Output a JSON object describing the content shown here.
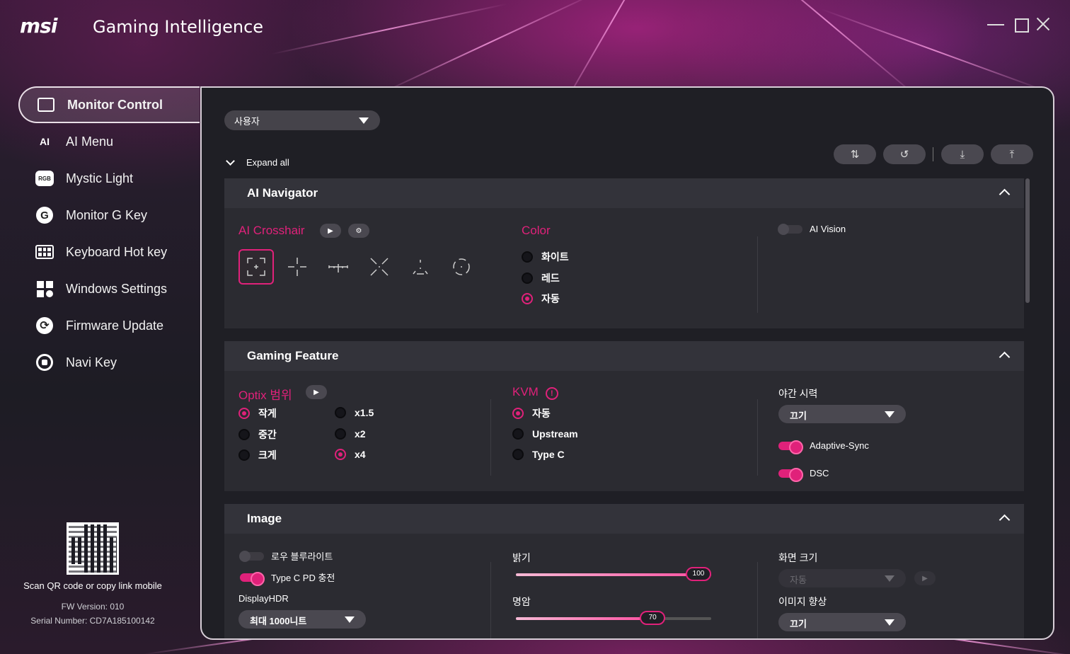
{
  "app": {
    "brand": "msi",
    "title": "Gaming Intelligence"
  },
  "sidebar": {
    "items": [
      {
        "label": "Monitor Control",
        "icon": "monitor-icon",
        "active": true
      },
      {
        "label": "AI Menu",
        "icon": "ai-menu-icon"
      },
      {
        "label": "Mystic Light",
        "icon": "rgb-icon",
        "icon_text": "RGB"
      },
      {
        "label": "Monitor G Key",
        "icon": "g-key-icon",
        "icon_text": "G"
      },
      {
        "label": "Keyboard Hot key",
        "icon": "keyboard-icon"
      },
      {
        "label": "Windows Settings",
        "icon": "windows-settings-icon"
      },
      {
        "label": "Firmware Update",
        "icon": "firmware-update-icon"
      },
      {
        "label": "Navi Key",
        "icon": "navi-key-icon"
      }
    ],
    "ai_icon_text": "AI",
    "qr_text": "Scan QR code or copy link mobile",
    "fw_version": "FW Version: 010",
    "serial": "Serial Number: CD7A185100142"
  },
  "main": {
    "profile": "사용자",
    "expand_all": "Expand all",
    "toolbar": [
      {
        "icon": "sort-icon",
        "glyph": "⇅"
      },
      {
        "icon": "reset-icon",
        "glyph": "↺"
      },
      {
        "icon": "import-icon",
        "glyph": "⤓"
      },
      {
        "icon": "export-icon",
        "glyph": "⤒"
      }
    ]
  },
  "ai_navigator": {
    "title": "AI Navigator",
    "crosshair_title": "AI Crosshair",
    "color_title": "Color",
    "colors": [
      {
        "label": "화이트",
        "selected": false
      },
      {
        "label": "레드",
        "selected": false
      },
      {
        "label": "자동",
        "selected": true
      }
    ],
    "ai_vision_label": "AI Vision",
    "ai_vision_on": false
  },
  "gaming_feature": {
    "title": "Gaming Feature",
    "optix_title": "Optix 범위",
    "optix_sizes": [
      {
        "label": "작게",
        "selected": true
      },
      {
        "label": "중간",
        "selected": false
      },
      {
        "label": "크게",
        "selected": false
      }
    ],
    "optix_zoom": [
      {
        "label": "x1.5",
        "selected": false
      },
      {
        "label": "x2",
        "selected": false
      },
      {
        "label": "x4",
        "selected": true
      }
    ],
    "kvm_title": "KVM",
    "kvm_warn": "!",
    "kvm_options": [
      {
        "label": "자동",
        "selected": true
      },
      {
        "label": "Upstream",
        "selected": false
      },
      {
        "label": "Type C",
        "selected": false
      }
    ],
    "night_vision_label": "야간 시력",
    "night_vision_value": "끄기",
    "adaptive_sync_label": "Adaptive-Sync",
    "adaptive_sync_on": true,
    "dsc_label": "DSC",
    "dsc_on": true
  },
  "image": {
    "title": "Image",
    "low_blue_label": "로우 블루라이트",
    "low_blue_on": false,
    "typec_pd_label": "Type C PD 충전",
    "typec_pd_on": true,
    "displayhdr_label": "DisplayHDR",
    "displayhdr_value": "최대 1000니트",
    "brightness_label": "밝기",
    "brightness_value": 100,
    "contrast_label": "명암",
    "contrast_value": 70,
    "screen_size_label": "화면 크기",
    "screen_size_value": "자동",
    "image_enhance_label": "이미지 향상",
    "image_enhance_value": "끄기"
  },
  "colors": {
    "accent": "#e0217a",
    "panel": "#1f1f25"
  }
}
